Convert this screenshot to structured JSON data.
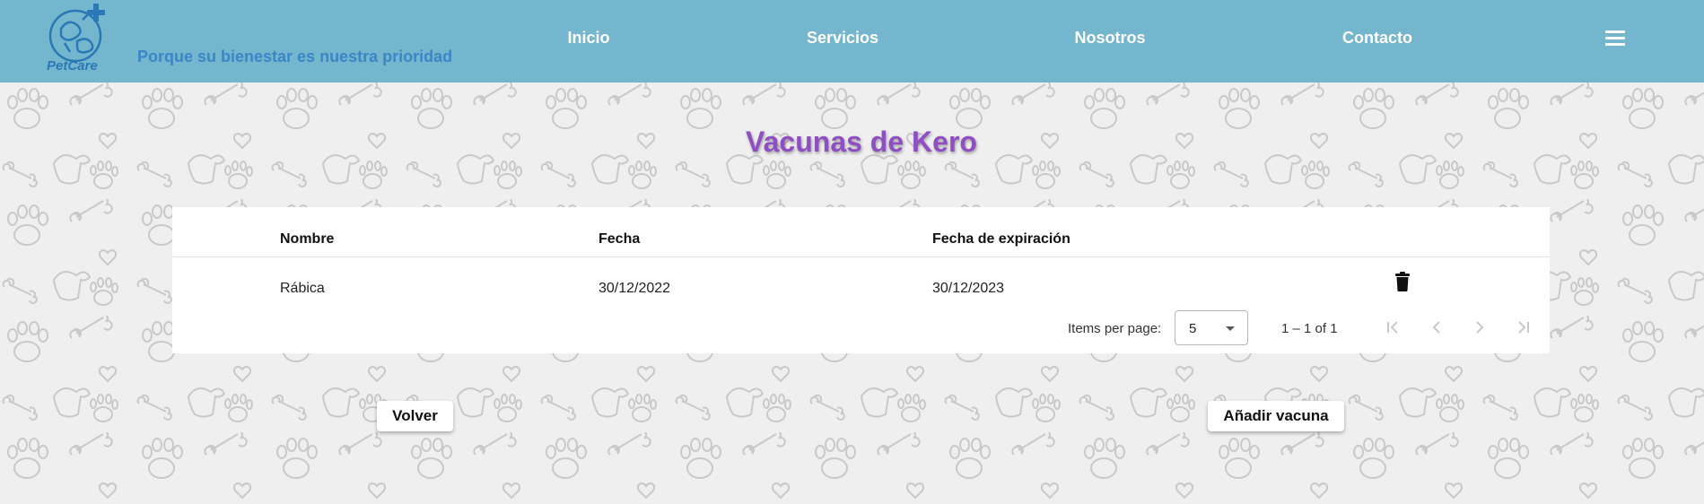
{
  "header": {
    "logo_text": "PetCare",
    "tagline": "Porque su bienestar es nuestra prioridad",
    "nav": [
      {
        "label": "Inicio"
      },
      {
        "label": "Servicios"
      },
      {
        "label": "Nosotros"
      },
      {
        "label": "Contacto"
      }
    ],
    "menu_icon": "hamburger-menu-icon",
    "background_color": "#74b6cd"
  },
  "main": {
    "title": "Vacunas de Kero",
    "title_color": "#8f4fc3",
    "table": {
      "columns": [
        "Nombre",
        "Fecha",
        "Fecha de expiración"
      ],
      "rows": [
        {
          "nombre": "Rábica",
          "fecha": "30/12/2022",
          "expiracion": "30/12/2023",
          "action_icon": "trash-icon"
        }
      ]
    },
    "paginator": {
      "items_per_page_label": "Items per page:",
      "page_size": "5",
      "range": "1 – 1 of 1",
      "icons": [
        "first-page-icon",
        "previous-page-icon",
        "next-page-icon",
        "last-page-icon"
      ]
    },
    "buttons": {
      "back": "Volver",
      "add": "Añadir vacuna"
    }
  }
}
